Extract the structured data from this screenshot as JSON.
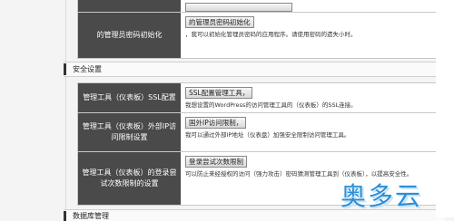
{
  "section_security": {
    "title": "安全设置"
  },
  "section_next": {
    "title": "数据库管理"
  },
  "rows_top": [
    {
      "label": "的管理员密码初始化",
      "button": "的管理员密码初始化",
      "desc": "，我可以初始化管理员密码的应用程序。请使用密码的遗失小时。"
    }
  ],
  "rows_security": [
    {
      "label": "管理工具（仪表板）SSL配置",
      "button": "SSL配置管理工具，",
      "desc": "我想设置的WordPress的访问管理工具的（仪表板）的SSL连接。"
    },
    {
      "label": "管理工具（仪表板）外部IP访问限制设置",
      "button": "国外IP访问限制，",
      "desc": "我可以通过外部IP地址（仪表盘）加强安全限制访问管理工具。"
    },
    {
      "label": "管理工具（仪表板）的登录尝试次数限制的设置",
      "button": "登录尝试次数限制",
      "desc": "可以防止来经授权的访问（强力攻击）密码猜测管理工具到（仪表板），以提高安全性。"
    }
  ],
  "watermark": "奥多云"
}
